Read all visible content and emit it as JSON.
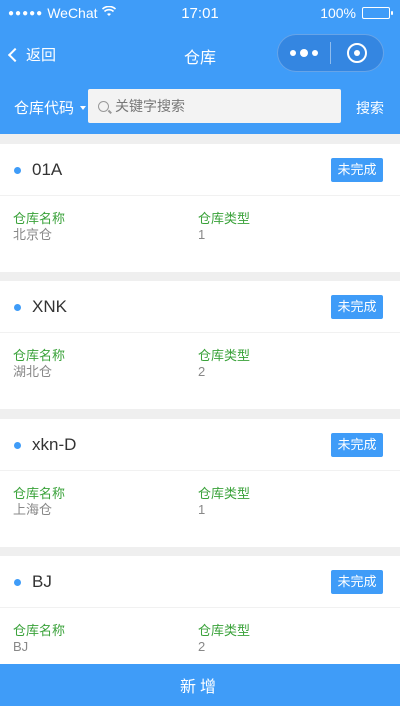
{
  "status_bar": {
    "carrier": "WeChat",
    "time": "17:01",
    "battery": "100%"
  },
  "nav": {
    "back_label": "返回",
    "title": "仓库"
  },
  "search": {
    "filter_label": "仓库代码",
    "placeholder": "关键字搜索",
    "button_label": "搜索"
  },
  "warehouses": [
    {
      "code": "01A",
      "status": "未完成",
      "name_label": "仓库名称",
      "name": "北京仓",
      "type_label": "仓库类型",
      "type": "1"
    },
    {
      "code": "XNK",
      "status": "未完成",
      "name_label": "仓库名称",
      "name": "湖北仓",
      "type_label": "仓库类型",
      "type": "2"
    },
    {
      "code": "xkn-D",
      "status": "未完成",
      "name_label": "仓库名称",
      "name": "上海仓",
      "type_label": "仓库类型",
      "type": "1"
    },
    {
      "code": "BJ",
      "status": "未完成",
      "name_label": "仓库名称",
      "name": "BJ",
      "type_label": "仓库类型",
      "type": "2"
    }
  ],
  "footer": {
    "add_label": "新增"
  },
  "colors": {
    "primary": "#3f9cf8",
    "label_green": "#3aa23a"
  }
}
